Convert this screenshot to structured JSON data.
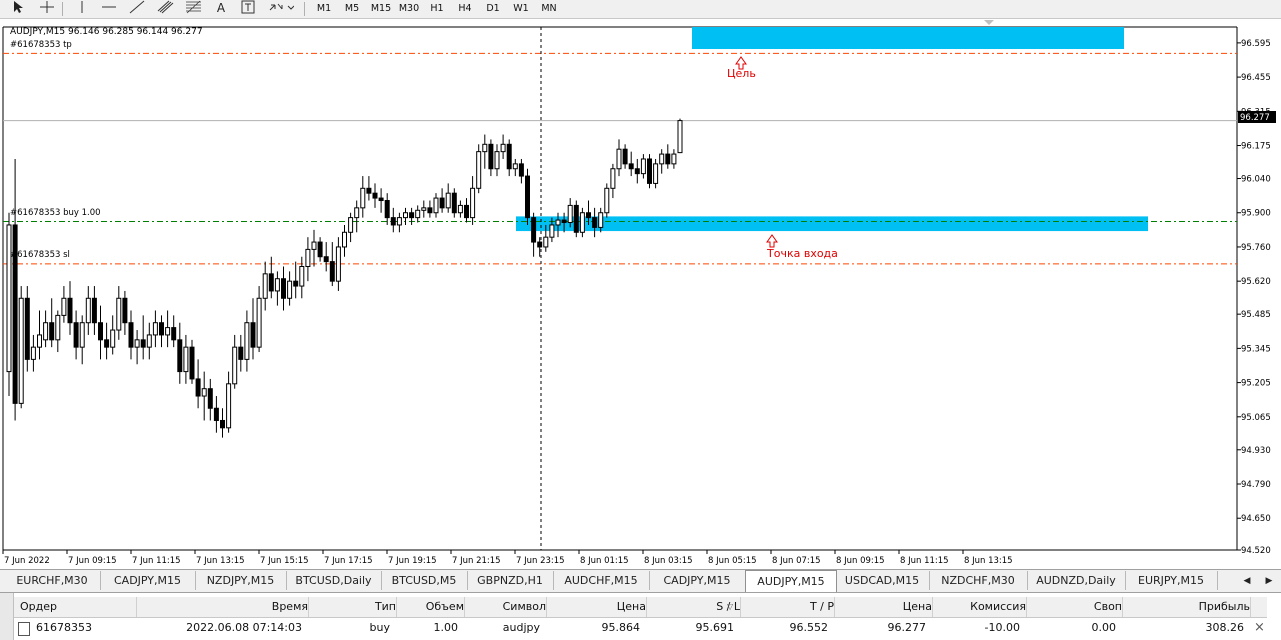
{
  "toolbar": {
    "icons": [
      "cursor-icon",
      "crosshair-icon",
      "vertical-line-icon",
      "horizontal-line-icon",
      "trendline-icon",
      "equidistant-channel-icon",
      "fibonacci-icon",
      "text-icon",
      "text-label-icon",
      "arrows-icon"
    ],
    "text_tool": "A",
    "timeframes": [
      "M1",
      "M5",
      "M15",
      "M30",
      "H1",
      "H4",
      "D1",
      "W1",
      "MN"
    ]
  },
  "chart": {
    "header": "AUDJPY,M15  96.146 96.285 96.144 96.277",
    "bid_label": "96.277",
    "order_lines": {
      "tp": "#61678353 tp",
      "buy": "#61678353 buy 1.00",
      "sl": "#61678353 sl"
    },
    "annotations": {
      "target": "Цель",
      "entry": "Точка входа"
    },
    "colors": {
      "zone": "#00bff3",
      "tp_sl_line": "#ff4500",
      "buy_line": "#008000",
      "annotation": "#ff0000",
      "up_candle": "#ffffff",
      "down_candle": "#000000"
    }
  },
  "chart_data": {
    "type": "candlestick",
    "symbol": "AUDJPY,M15",
    "y_ticks": [
      "96.595",
      "96.455",
      "96.315",
      "96.175",
      "96.040",
      "95.900",
      "95.760",
      "95.620",
      "95.485",
      "95.345",
      "95.205",
      "95.065",
      "94.930",
      "94.790",
      "94.650",
      "94.520"
    ],
    "ylim": [
      94.52,
      96.66
    ],
    "x_ticks": [
      "7 Jun 2022",
      "7 Jun 09:15",
      "7 Jun 11:15",
      "7 Jun 13:15",
      "7 Jun 15:15",
      "7 Jun 17:15",
      "7 Jun 19:15",
      "7 Jun 21:15",
      "7 Jun 23:15",
      "8 Jun 01:15",
      "8 Jun 03:15",
      "8 Jun 05:15",
      "8 Jun 07:15",
      "8 Jun 09:15",
      "8 Jun 11:15",
      "8 Jun 13:15"
    ],
    "levels": {
      "tp": 96.552,
      "entry": 95.864,
      "sl": 95.691,
      "bid": 96.277
    },
    "candles": [
      [
        95.25,
        95.9,
        95.15,
        95.85
      ],
      [
        95.85,
        96.12,
        95.05,
        95.12
      ],
      [
        95.12,
        95.6,
        95.1,
        95.55
      ],
      [
        95.55,
        95.6,
        95.25,
        95.3
      ],
      [
        95.3,
        95.4,
        95.25,
        95.35
      ],
      [
        95.35,
        95.5,
        95.3,
        95.4
      ],
      [
        95.38,
        95.5,
        95.35,
        95.45
      ],
      [
        95.45,
        95.55,
        95.35,
        95.38
      ],
      [
        95.38,
        95.5,
        95.33,
        95.48
      ],
      [
        95.48,
        95.6,
        95.45,
        95.55
      ],
      [
        95.55,
        95.62,
        95.4,
        95.45
      ],
      [
        95.45,
        95.5,
        95.3,
        95.35
      ],
      [
        95.35,
        95.48,
        95.28,
        95.45
      ],
      [
        95.45,
        95.6,
        95.4,
        95.55
      ],
      [
        95.55,
        95.6,
        95.4,
        95.45
      ],
      [
        95.45,
        95.52,
        95.3,
        95.38
      ],
      [
        95.38,
        95.45,
        95.3,
        95.35
      ],
      [
        95.35,
        95.48,
        95.32,
        95.42
      ],
      [
        95.42,
        95.6,
        95.38,
        95.55
      ],
      [
        95.55,
        95.58,
        95.4,
        95.45
      ],
      [
        95.45,
        95.5,
        95.3,
        95.35
      ],
      [
        95.35,
        95.42,
        95.28,
        95.38
      ],
      [
        95.38,
        95.48,
        95.3,
        95.35
      ],
      [
        95.35,
        95.45,
        95.3,
        95.4
      ],
      [
        95.4,
        95.5,
        95.35,
        95.45
      ],
      [
        95.45,
        95.48,
        95.35,
        95.4
      ],
      [
        95.4,
        95.5,
        95.35,
        95.43
      ],
      [
        95.43,
        95.48,
        95.35,
        95.38
      ],
      [
        95.38,
        95.45,
        95.2,
        95.25
      ],
      [
        95.25,
        95.4,
        95.2,
        95.35
      ],
      [
        95.35,
        95.38,
        95.2,
        95.22
      ],
      [
        95.22,
        95.3,
        95.1,
        95.15
      ],
      [
        95.15,
        95.25,
        95.05,
        95.18
      ],
      [
        95.18,
        95.22,
        95.05,
        95.1
      ],
      [
        95.1,
        95.15,
        95.0,
        95.05
      ],
      [
        95.05,
        95.1,
        94.98,
        95.02
      ],
      [
        95.02,
        95.25,
        95.0,
        95.2
      ],
      [
        95.2,
        95.4,
        95.18,
        95.35
      ],
      [
        95.35,
        95.4,
        95.25,
        95.3
      ],
      [
        95.3,
        95.5,
        95.25,
        95.45
      ],
      [
        95.45,
        95.55,
        95.3,
        95.35
      ],
      [
        95.35,
        95.6,
        95.33,
        95.55
      ],
      [
        95.55,
        95.7,
        95.5,
        95.65
      ],
      [
        95.65,
        95.72,
        95.55,
        95.58
      ],
      [
        95.58,
        95.66,
        95.52,
        95.63
      ],
      [
        95.63,
        95.68,
        95.5,
        95.55
      ],
      [
        95.55,
        95.66,
        95.52,
        95.62
      ],
      [
        95.62,
        95.7,
        95.55,
        95.6
      ],
      [
        95.6,
        95.72,
        95.55,
        95.68
      ],
      [
        95.68,
        95.8,
        95.62,
        95.75
      ],
      [
        95.75,
        95.83,
        95.68,
        95.78
      ],
      [
        95.78,
        95.8,
        95.7,
        95.72
      ],
      [
        95.72,
        95.78,
        95.66,
        95.7
      ],
      [
        95.7,
        95.78,
        95.6,
        95.62
      ],
      [
        95.62,
        95.8,
        95.58,
        95.76
      ],
      [
        95.76,
        95.85,
        95.72,
        95.82
      ],
      [
        95.82,
        95.9,
        95.78,
        95.88
      ],
      [
        95.88,
        95.95,
        95.82,
        95.92
      ],
      [
        95.92,
        96.05,
        95.88,
        96.0
      ],
      [
        96.0,
        96.05,
        95.95,
        95.98
      ],
      [
        95.98,
        96.02,
        95.92,
        95.96
      ],
      [
        95.96,
        96.0,
        95.9,
        95.95
      ],
      [
        95.95,
        95.98,
        95.85,
        95.88
      ],
      [
        95.88,
        95.92,
        95.82,
        95.85
      ],
      [
        95.85,
        95.9,
        95.82,
        95.88
      ],
      [
        95.88,
        95.92,
        95.85,
        95.9
      ],
      [
        95.9,
        95.92,
        95.85,
        95.88
      ],
      [
        95.88,
        95.93,
        95.86,
        95.91
      ],
      [
        95.91,
        95.95,
        95.88,
        95.92
      ],
      [
        95.92,
        95.95,
        95.88,
        95.9
      ],
      [
        95.9,
        95.98,
        95.88,
        95.96
      ],
      [
        95.96,
        96.0,
        95.9,
        95.92
      ],
      [
        95.92,
        96.02,
        95.9,
        95.98
      ],
      [
        95.98,
        96.0,
        95.88,
        95.9
      ],
      [
        95.9,
        95.95,
        95.88,
        95.93
      ],
      [
        95.93,
        95.96,
        95.86,
        95.88
      ],
      [
        95.88,
        96.05,
        95.85,
        96.0
      ],
      [
        96.0,
        96.18,
        95.98,
        96.15
      ],
      [
        96.15,
        96.22,
        96.08,
        96.18
      ],
      [
        96.18,
        96.2,
        96.05,
        96.08
      ],
      [
        96.08,
        96.18,
        96.05,
        96.15
      ],
      [
        96.15,
        96.22,
        96.12,
        96.18
      ],
      [
        96.18,
        96.2,
        96.05,
        96.08
      ],
      [
        96.08,
        96.12,
        96.05,
        96.1
      ],
      [
        96.1,
        96.12,
        96.02,
        96.05
      ],
      [
        96.05,
        96.08,
        95.85,
        95.88
      ],
      [
        95.88,
        95.9,
        95.72,
        95.78
      ],
      [
        95.78,
        95.8,
        95.72,
        95.76
      ],
      [
        95.76,
        95.85,
        95.74,
        95.8
      ],
      [
        95.8,
        95.88,
        95.78,
        95.85
      ],
      [
        95.85,
        95.9,
        95.8,
        95.87
      ],
      [
        95.87,
        95.9,
        95.82,
        95.86
      ],
      [
        95.86,
        95.96,
        95.84,
        95.93
      ],
      [
        95.93,
        95.95,
        95.8,
        95.82
      ],
      [
        95.82,
        95.92,
        95.8,
        95.9
      ],
      [
        95.9,
        95.95,
        95.85,
        95.88
      ],
      [
        95.88,
        95.92,
        95.8,
        95.84
      ],
      [
        95.84,
        95.92,
        95.82,
        95.9
      ],
      [
        95.9,
        96.02,
        95.88,
        96.0
      ],
      [
        96.0,
        96.1,
        95.96,
        96.08
      ],
      [
        96.08,
        96.2,
        96.05,
        96.16
      ],
      [
        96.16,
        96.18,
        96.08,
        96.1
      ],
      [
        96.1,
        96.15,
        96.05,
        96.08
      ],
      [
        96.08,
        96.12,
        96.02,
        96.06
      ],
      [
        96.06,
        96.14,
        96.04,
        96.12
      ],
      [
        96.12,
        96.14,
        96.0,
        96.02
      ],
      [
        96.02,
        96.12,
        96.0,
        96.1
      ],
      [
        96.1,
        96.16,
        96.06,
        96.14
      ],
      [
        96.14,
        96.18,
        96.08,
        96.1
      ],
      [
        96.1,
        96.16,
        96.08,
        96.14
      ],
      [
        96.146,
        96.285,
        96.144,
        96.277
      ]
    ]
  },
  "symbol_tabs": [
    "EURCHF,M30",
    "CADJPY,M15",
    "NZDJPY,M15",
    "BTCUSD,Daily",
    "BTCUSD,M5",
    "GBPNZD,H1",
    "AUDCHF,M15",
    "CADJPY,M15",
    "AUDJPY,M15",
    "USDCAD,M15",
    "NZDCHF,M30",
    "AUDNZD,Daily",
    "EURJPY,M15"
  ],
  "active_tab": "AUDJPY,M15",
  "terminal": {
    "headers": [
      "Ордер",
      "Время",
      "Тип",
      "Объем",
      "Символ",
      "Цена",
      "S / L",
      "T / P",
      "Цена",
      "Комиссия",
      "Своп",
      "Прибыль"
    ],
    "row": [
      "61678353",
      "2022.06.08 07:14:03",
      "buy",
      "1.00",
      "audjpy",
      "95.864",
      "95.691",
      "96.552",
      "96.277",
      "-10.00",
      "0.00",
      "308.26"
    ]
  }
}
